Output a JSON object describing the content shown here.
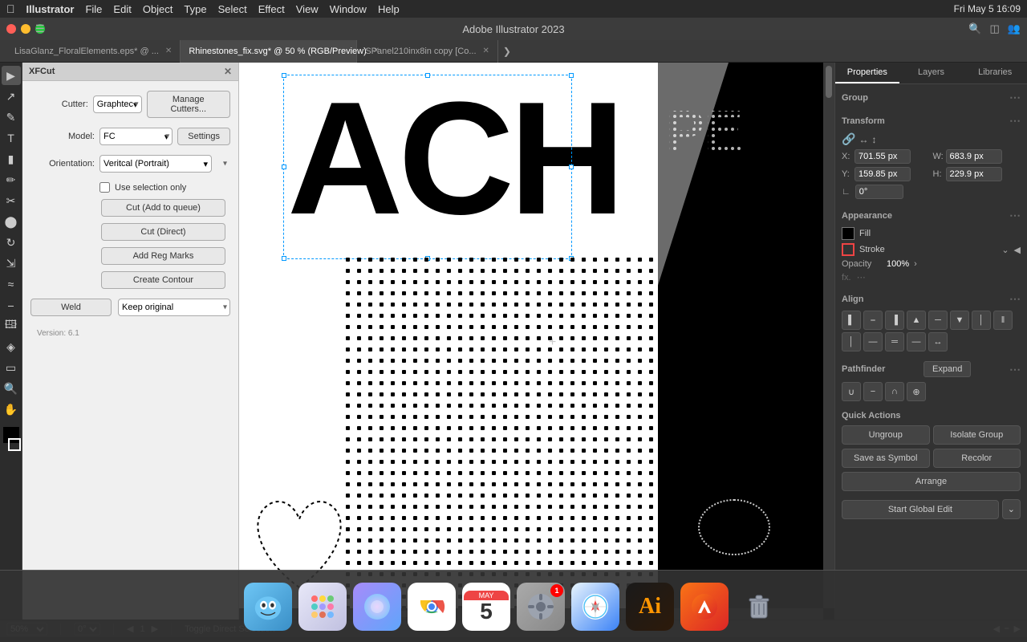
{
  "menubar": {
    "apple": "⌘",
    "app": "Illustrator",
    "items": [
      "File",
      "Edit",
      "Object",
      "Type",
      "Select",
      "Effect",
      "View",
      "Window",
      "Help"
    ],
    "right": [
      "Fri May 5  16:09"
    ]
  },
  "titlebar": {
    "title": "Adobe Illustrator 2023"
  },
  "tabs": [
    {
      "label": "LisaGlanz_FloralElements.eps* @ ...",
      "active": false,
      "closeable": true
    },
    {
      "label": "Rhinestones_fix.svg* @ 50 % (RGB/Preview)",
      "active": true,
      "closeable": true
    },
    {
      "label": "SPanel210inx8in copy [Co...",
      "active": false,
      "closeable": true
    }
  ],
  "xfcut": {
    "title": "XFCut",
    "fields": {
      "cutter_label": "Cutter:",
      "cutter_value": "Graphtec",
      "model_label": "Model:",
      "model_value": "FC",
      "orientation_label": "Orientation:",
      "orientation_value": "Veritcal (Portrait)"
    },
    "buttons": {
      "manage_cutters": "Manage Cutters...",
      "settings": "Settings",
      "cut_add": "Cut (Add to queue)",
      "cut_direct": "Cut (Direct)",
      "add_reg_marks": "Add Reg Marks",
      "create_contour": "Create Contour",
      "weld": "Weld",
      "keep_original": "Keep original"
    },
    "checkbox": {
      "label": "Use selection only"
    },
    "version": "Version: 6.1"
  },
  "properties": {
    "tabs": [
      "Properties",
      "Layers",
      "Libraries"
    ],
    "active_tab": "Properties",
    "group_label": "Group",
    "transform": {
      "label": "Transform",
      "x_label": "X:",
      "x_value": "701.55 px",
      "y_label": "Y:",
      "y_value": "159.85 px",
      "w_label": "W:",
      "w_value": "683.9 px",
      "h_label": "H:",
      "h_value": "229.9 px",
      "angle": "0°"
    },
    "appearance": {
      "label": "Appearance",
      "fill_label": "Fill",
      "stroke_label": "Stroke",
      "opacity_label": "Opacity",
      "opacity_value": "100%",
      "fx_label": "fx."
    },
    "align": {
      "label": "Align",
      "buttons": [
        "align-left",
        "align-center",
        "align-right",
        "align-top",
        "align-middle",
        "align-bottom",
        "distribute-left",
        "distribute-center",
        "distribute-right",
        "distribute-top",
        "distribute-middle",
        "distribute-bottom",
        "distribute-spacing"
      ]
    },
    "pathfinder": {
      "label": "Pathfinder",
      "buttons": [
        "unite",
        "minus-front",
        "intersect",
        "exclude"
      ],
      "expand_label": "Expand"
    },
    "quick_actions": {
      "label": "Quick Actions",
      "ungroup": "Ungroup",
      "isolate_group": "Isolate Group",
      "save_as_symbol": "Save as Symbol",
      "recolor": "Recolor",
      "arrange": "Arrange",
      "start_global_edit": "Start Global Edit"
    }
  },
  "status_bar": {
    "zoom": "50%",
    "angle": "0°",
    "page": "1",
    "tool_toggle": "Toggle Direct Selection"
  },
  "dock": {
    "items": [
      {
        "name": "Finder",
        "emoji": "🙂",
        "color": "dock-finder"
      },
      {
        "name": "Launchpad",
        "emoji": "⊞",
        "color": "dock-launchpad"
      },
      {
        "name": "Siri",
        "emoji": "◎",
        "color": "dock-siri"
      },
      {
        "name": "Chrome",
        "emoji": "⊕",
        "color": "dock-chrome"
      },
      {
        "name": "Calendar",
        "emoji": "5",
        "color": "dock-calendar"
      },
      {
        "name": "System Preferences",
        "emoji": "⚙",
        "color": "dock-settings",
        "badge": "1"
      },
      {
        "name": "Safari",
        "emoji": "◎",
        "color": "dock-safari"
      },
      {
        "name": "Illustrator",
        "emoji": "Ai",
        "color": "dock-ai"
      },
      {
        "name": "Pixel",
        "emoji": "✏",
        "color": "dock-pixel"
      },
      {
        "name": "Trash",
        "emoji": "🗑",
        "color": "dock-trash"
      }
    ]
  }
}
